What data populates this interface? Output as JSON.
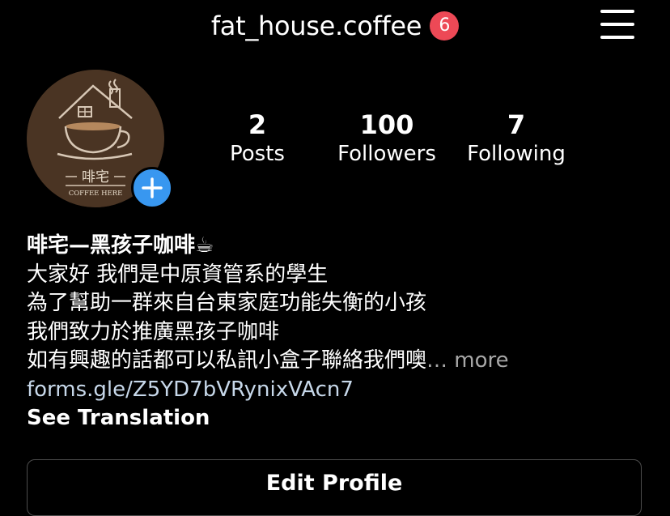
{
  "header": {
    "username": "fat_house.coffee",
    "notification_count": "6"
  },
  "profile": {
    "logo_text_cn": "啡宅",
    "logo_text_en": "COFFEE HERE"
  },
  "stats": [
    {
      "value": "2",
      "label": "Posts"
    },
    {
      "value": "100",
      "label": "Followers"
    },
    {
      "value": "7",
      "label": "Following"
    }
  ],
  "bio": {
    "name": "啡宅—黑孩子咖啡☕",
    "lines": [
      "大家好 我們是中原資管系的學生",
      "為了幫助一群來自台東家庭功能失衡的小孩",
      "我們致力於推廣黑孩子咖啡",
      "如有興趣的話都可以私訊小盒子聯絡我們噢"
    ],
    "more": "… more",
    "link": "forms.gle/Z5YD7bVRynixVAcn7",
    "see_translation": "See Translation"
  },
  "actions": {
    "edit_profile": "Edit Profile"
  },
  "colors": {
    "background": "#000000",
    "badge": "#ed4956",
    "add_button": "#3897f0",
    "link": "#c7d8ea",
    "muted": "#a8a8a8"
  }
}
